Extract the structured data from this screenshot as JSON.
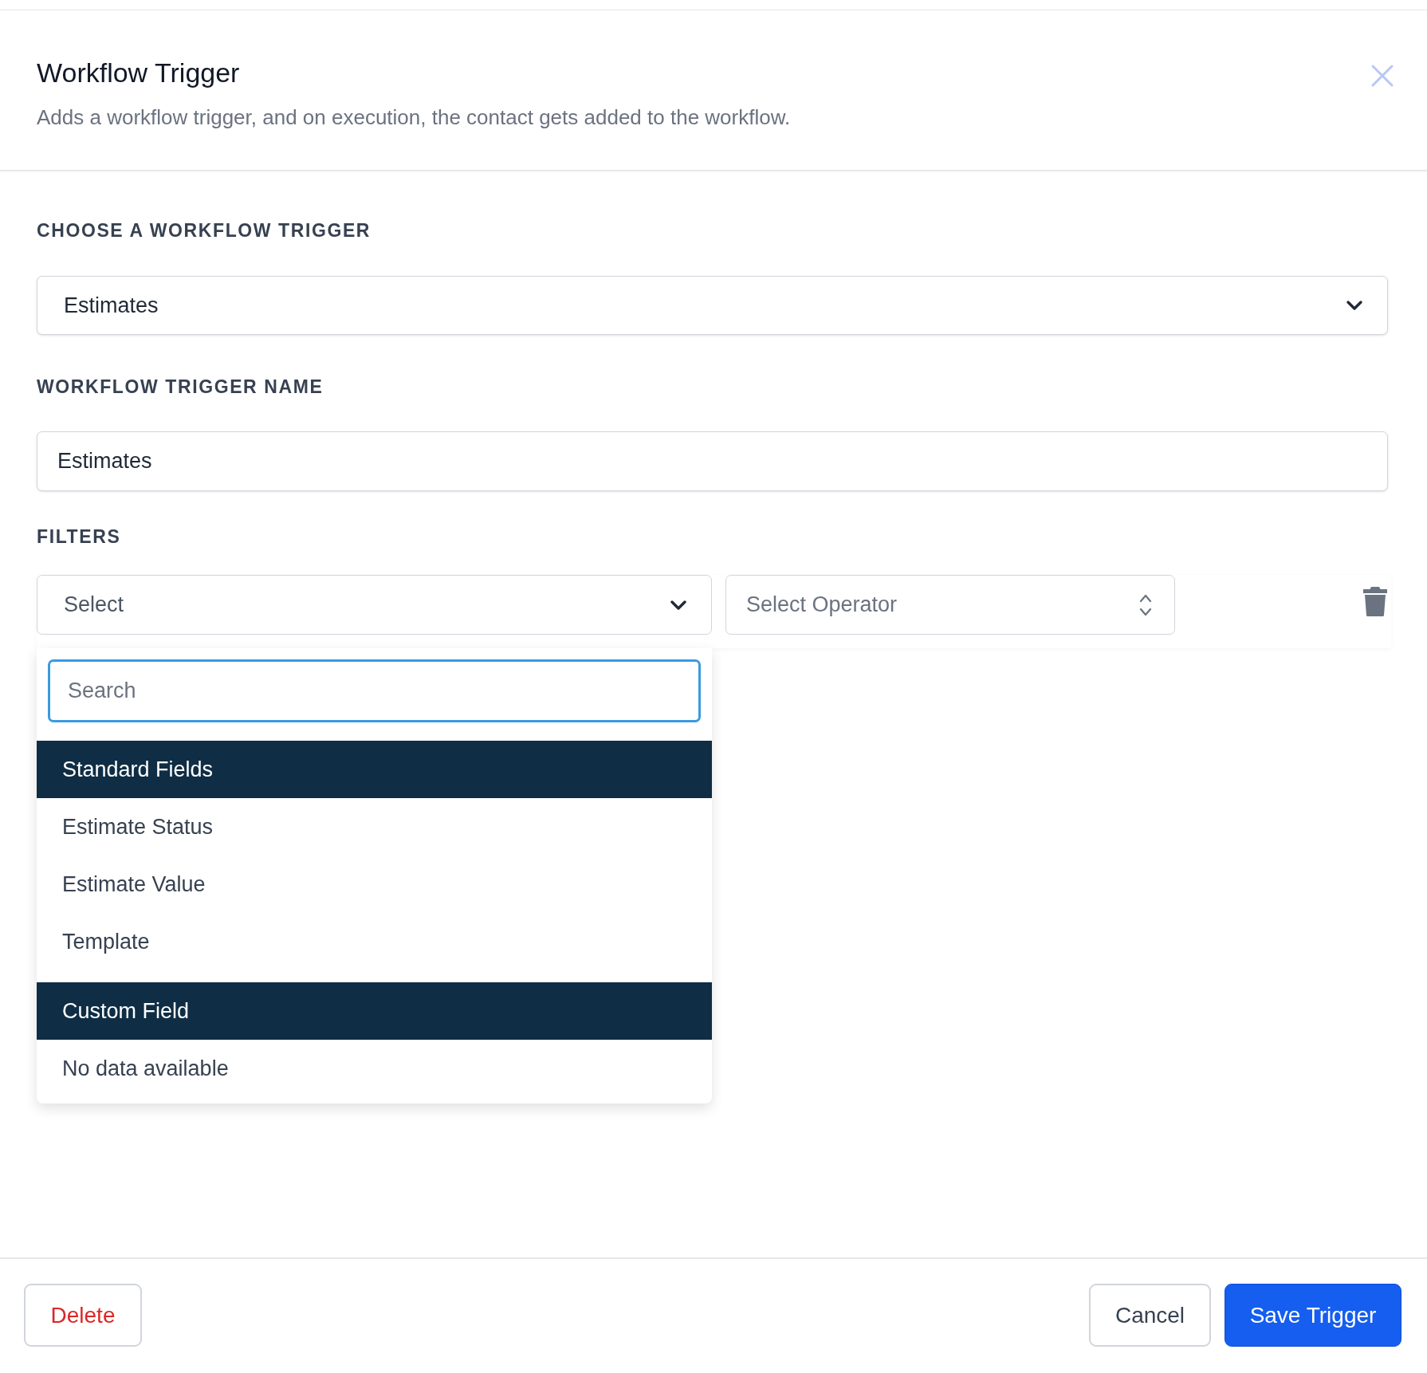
{
  "dialog": {
    "title": "Workflow Trigger",
    "subtitle": "Adds a workflow trigger, and on execution, the contact gets added to the workflow."
  },
  "trigger": {
    "label": "CHOOSE A WORKFLOW TRIGGER",
    "value": "Estimates"
  },
  "trigger_name": {
    "label": "WORKFLOW TRIGGER NAME",
    "value": "Estimates"
  },
  "filters": {
    "label": "FILTERS",
    "field_select": {
      "placeholder": "Select",
      "expanded": true
    },
    "operator_select": {
      "placeholder": "Select Operator"
    }
  },
  "dropdown": {
    "search": {
      "placeholder": "Search",
      "focused": true
    },
    "options": [
      {
        "kind": "header",
        "label": "Standard Fields"
      },
      {
        "kind": "option",
        "label": "Estimate Status"
      },
      {
        "kind": "option",
        "label": "Estimate Value"
      },
      {
        "kind": "option",
        "label": "Template"
      },
      {
        "kind": "header",
        "label": "Custom Field"
      },
      {
        "kind": "empty",
        "label": "No data available"
      }
    ]
  },
  "footer": {
    "buttons": [
      {
        "kind": "danger",
        "label": "Delete"
      },
      {
        "kind": "secondary",
        "label": "Cancel"
      },
      {
        "kind": "primary",
        "label": "Save Trigger"
      }
    ]
  }
}
